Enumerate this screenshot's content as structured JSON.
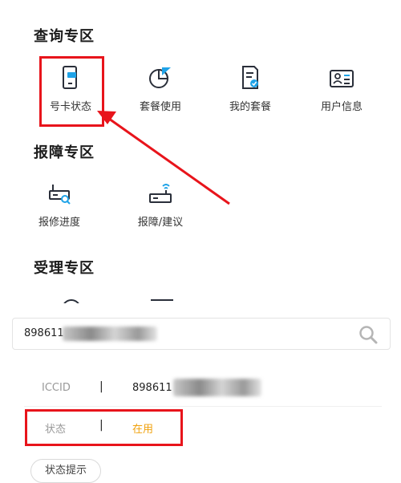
{
  "sections": {
    "query_title": "查询专区",
    "fault_title": "报障专区",
    "accept_title": "受理专区"
  },
  "query_items": [
    {
      "label": "号卡状态",
      "icon": "sim-card-icon"
    },
    {
      "label": "套餐使用",
      "icon": "pie-chart-icon"
    },
    {
      "label": "我的套餐",
      "icon": "document-check-icon"
    },
    {
      "label": "用户信息",
      "icon": "id-card-icon"
    }
  ],
  "fault_items": [
    {
      "label": "报修进度",
      "icon": "router-search-icon"
    },
    {
      "label": "报障/建议",
      "icon": "router-wifi-icon"
    }
  ],
  "search": {
    "value": "898611"
  },
  "details": {
    "iccid_label": "ICCID",
    "iccid_value": "898611",
    "separator": "|",
    "status_label": "状态",
    "status_value": "在用"
  },
  "partial_button_label": "状态提示",
  "colors": {
    "highlight": "#e8141b",
    "status_active": "#f0a10c",
    "icon_stroke": "#2a2f3a",
    "icon_accent": "#1fa3e8"
  }
}
